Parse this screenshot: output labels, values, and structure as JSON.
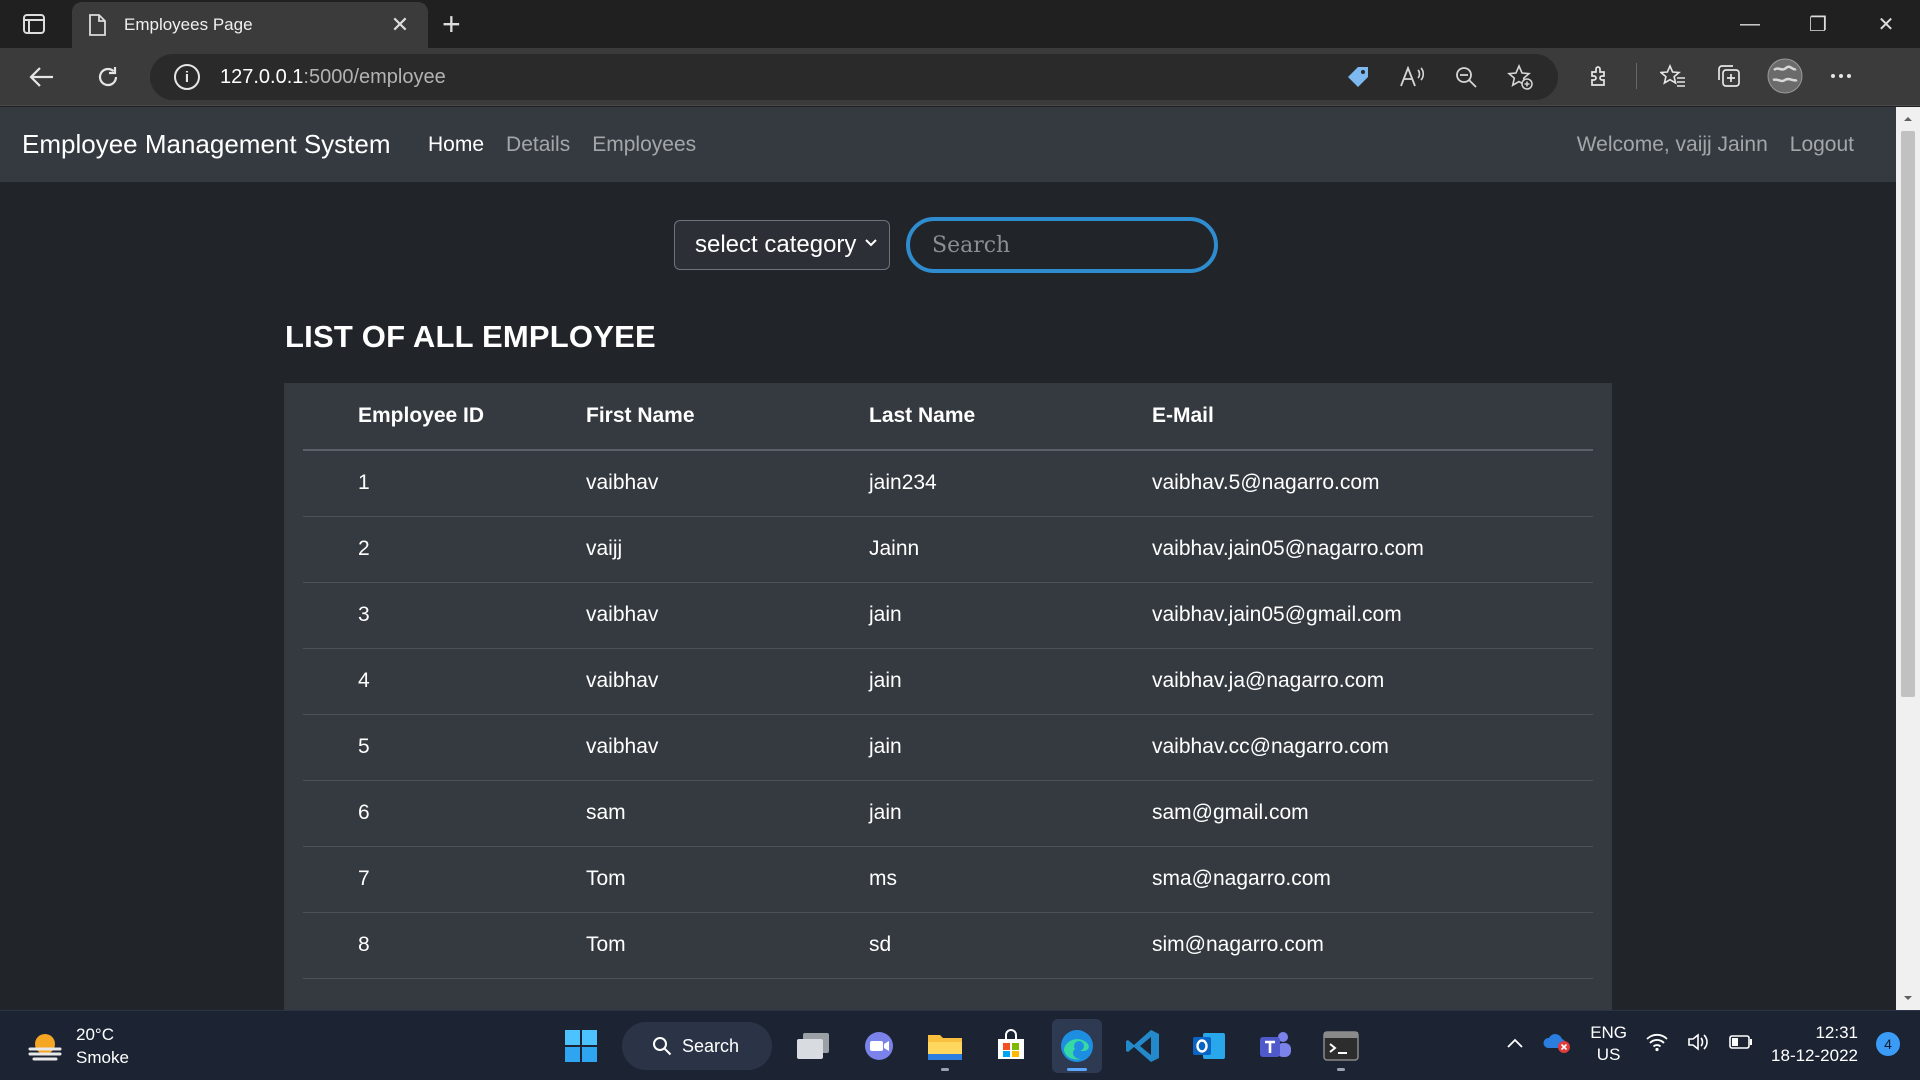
{
  "browser": {
    "tab_title": "Employees Page",
    "url_host": "127.0.0.1",
    "url_path": ":5000/employee"
  },
  "navbar": {
    "brand": "Employee Management System",
    "links": [
      "Home",
      "Details",
      "Employees"
    ],
    "welcome": "Welcome, vaijj Jainn",
    "logout": "Logout"
  },
  "search": {
    "category_selected": "select category",
    "placeholder": "Search"
  },
  "list_title": "LIST OF ALL EMPLOYEE",
  "table": {
    "headers": [
      "Employee ID",
      "First Name",
      "Last Name",
      "E-Mail"
    ],
    "rows": [
      [
        "1",
        "vaibhav",
        "jain234",
        "vaibhav.5@nagarro.com"
      ],
      [
        "2",
        "vaijj",
        "Jainn",
        "vaibhav.jain05@nagarro.com"
      ],
      [
        "3",
        "vaibhav",
        "jain",
        "vaibhav.jain05@gmail.com"
      ],
      [
        "4",
        "vaibhav",
        "jain",
        "vaibhav.ja@nagarro.com"
      ],
      [
        "5",
        "vaibhav",
        "jain",
        "vaibhav.cc@nagarro.com"
      ],
      [
        "6",
        "sam",
        "jain",
        "sam@gmail.com"
      ],
      [
        "7",
        "Tom",
        "ms",
        "sma@nagarro.com"
      ],
      [
        "8",
        "Tom",
        "sd",
        "sim@nagarro.com"
      ]
    ]
  },
  "taskbar": {
    "weather_temp": "20°C",
    "weather_desc": "Smoke",
    "search_label": "Search",
    "lang_1": "ENG",
    "lang_2": "US",
    "time": "12:31",
    "date": "18-12-2022",
    "notification_count": "4"
  },
  "colors": {
    "accent": "#2f8ccf",
    "navbar_bg": "#343a40",
    "page_bg": "#212529"
  }
}
